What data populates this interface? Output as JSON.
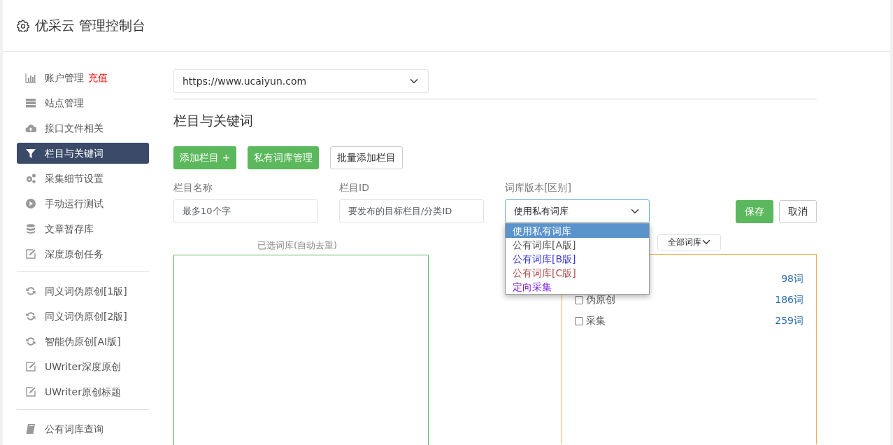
{
  "header": {
    "title": "优采云 管理控制台"
  },
  "sidebar": {
    "groups": [
      [
        {
          "kind": "chart",
          "label": "账户管理",
          "tag": "充值",
          "selected": false
        },
        {
          "kind": "server",
          "label": "站点管理",
          "selected": false
        },
        {
          "kind": "cloud",
          "label": "接口文件相关",
          "selected": false
        },
        {
          "kind": "filter",
          "label": "栏目与关键词",
          "selected": true
        },
        {
          "kind": "gears",
          "label": "采集细节设置",
          "selected": false
        },
        {
          "kind": "play",
          "label": "手动运行测试",
          "selected": false
        },
        {
          "kind": "database",
          "label": "文章暂存库",
          "selected": false
        },
        {
          "kind": "edit",
          "label": "深度原创任务",
          "selected": false
        }
      ],
      [
        {
          "kind": "refresh",
          "label": "同义词伪原创[1版]",
          "selected": false
        },
        {
          "kind": "refresh",
          "label": "同义词伪原创[2版]",
          "selected": false
        },
        {
          "kind": "refresh",
          "label": "智能伪原创[AI版]",
          "selected": false
        },
        {
          "kind": "edit",
          "label": "UWriter深度原创",
          "selected": false
        },
        {
          "kind": "edit",
          "label": "UWriter原创标题",
          "selected": false
        }
      ],
      [
        {
          "kind": "book",
          "label": "公有词库查询",
          "selected": false
        }
      ]
    ]
  },
  "site_select": {
    "value": "https://www.ucaiyun.com"
  },
  "section_title": "栏目与关键词",
  "toolbar": [
    {
      "kind": "green",
      "label": "添加栏目 +"
    },
    {
      "kind": "green",
      "label": "私有词库管理"
    },
    {
      "kind": "plain",
      "label": "批量添加栏目"
    }
  ],
  "form": {
    "fields": [
      {
        "label": "栏目名称",
        "placeholder": "最多10个字"
      },
      {
        "label": "栏目ID",
        "placeholder": "要发布的目标栏目/分类ID"
      }
    ],
    "version_select": {
      "label": "词库版本[区别]",
      "value": "使用私有词库",
      "expanded": true,
      "options": [
        {
          "label": "使用私有词库",
          "selected": true
        },
        {
          "label": "公有词库[A版]",
          "selected": false,
          "color": "#555555"
        },
        {
          "label": "公有词库[B版]",
          "selected": false,
          "color": "#3a3ad8"
        },
        {
          "label": "公有词库[C版]",
          "selected": false,
          "color": "#b05050"
        },
        {
          "label": "定向采集",
          "selected": false,
          "color": "#7a1ee0"
        }
      ]
    },
    "buttons": [
      {
        "kind": "save",
        "label": "保存"
      },
      {
        "kind": "cancel",
        "label": "取消"
      }
    ]
  },
  "selected_panel": {
    "title": "已选词库(自动去重)"
  },
  "library_panel": {
    "filter": "全部词库",
    "items": [
      {
        "count": "98词"
      },
      {
        "label": "伪原创",
        "count": "186词",
        "checked": false
      },
      {
        "label": "采集",
        "count": "259词",
        "checked": false
      }
    ]
  }
}
